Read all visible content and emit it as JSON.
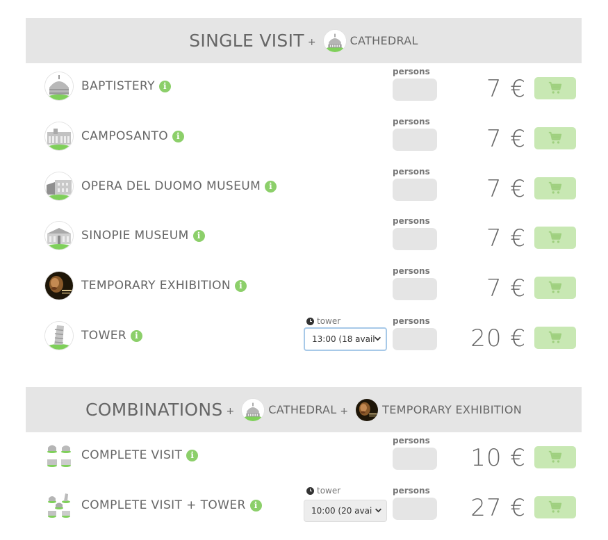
{
  "single_visit": {
    "title": "SINGLE VISIT",
    "plus": "+",
    "cathedral_label": "CATHEDRAL"
  },
  "combinations": {
    "title": "COMBINATIONS",
    "plus1": "+",
    "cathedral_label": "CATHEDRAL",
    "plus2": "+",
    "exhibition_label": "TEMPORARY EXHIBITION"
  },
  "common": {
    "persons_label": "persons",
    "info_glyph": "i",
    "tower_label": "tower",
    "cart_icon": "cart-icon"
  },
  "rows": [
    {
      "title": "BAPTISTERY",
      "price": "7 €"
    },
    {
      "title": "CAMPOSANTO",
      "price": "7 €"
    },
    {
      "title": "OPERA DEL DUOMO MUSEUM",
      "price": "7 €"
    },
    {
      "title": "SINOPIE MUSEUM",
      "price": "7 €"
    },
    {
      "title": "TEMPORARY EXHIBITION",
      "price": "7 €"
    },
    {
      "title": "TOWER",
      "price": "20 €",
      "time_selected": "13:00 (18 avail"
    }
  ],
  "combo_rows": [
    {
      "title": "COMPLETE VISIT",
      "price": "10 €"
    },
    {
      "title": "COMPLETE VISIT + TOWER",
      "price": "27 €",
      "time_selected": "10:00 (20 avai"
    }
  ],
  "colors": {
    "header_bg": "#e5e5e5",
    "accent_green": "#8ccf6a",
    "cart_bg": "#c8e8b3",
    "input_bg": "#e5e5e5",
    "text": "#666666"
  }
}
